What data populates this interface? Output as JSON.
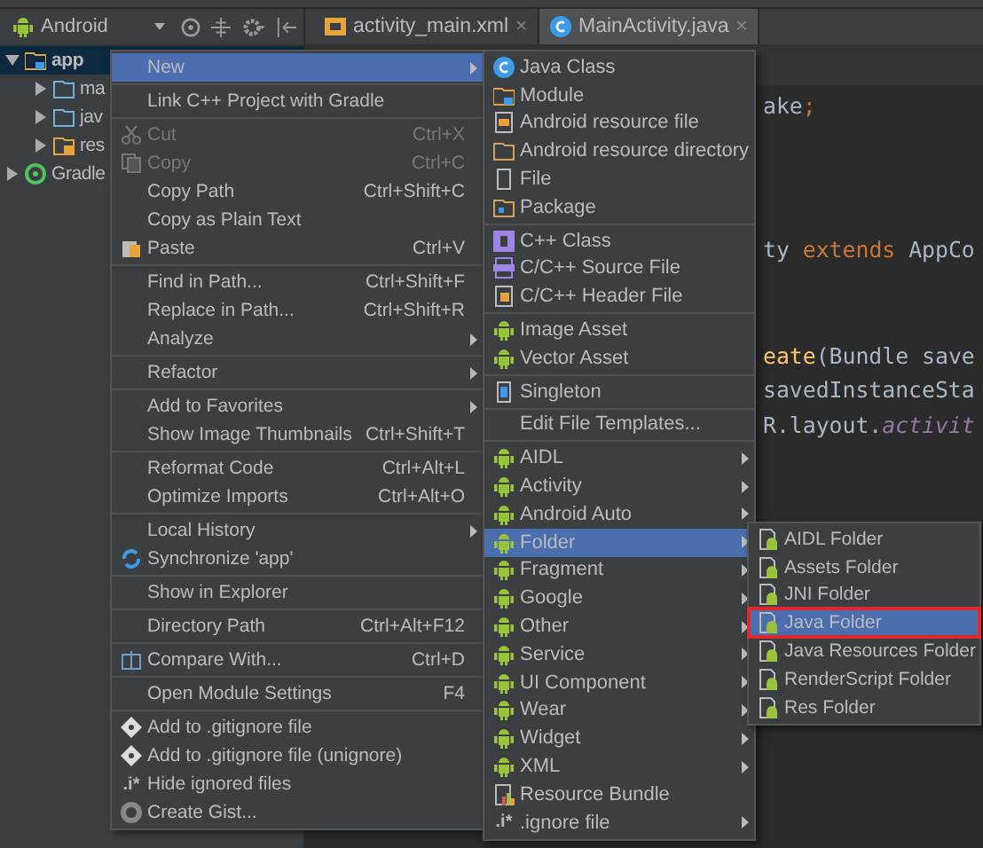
{
  "project_panel": {
    "view": "Android",
    "tree": [
      {
        "label": "app",
        "kind": "module",
        "selected": true,
        "expanded": true,
        "children": [
          {
            "label": "ma",
            "kind": "folder",
            "selected": false,
            "expanded": false
          },
          {
            "label": "jav",
            "kind": "folder",
            "selected": false,
            "expanded": false
          },
          {
            "label": "res",
            "kind": "res",
            "selected": false,
            "expanded": false
          }
        ]
      },
      {
        "label": "Gradle",
        "kind": "gradle",
        "selected": false,
        "expanded": false
      }
    ]
  },
  "tabs": [
    {
      "label": "activity_main.xml",
      "kind": "xml",
      "close": "×",
      "selected": false
    },
    {
      "label": "MainActivity.java",
      "kind": "class",
      "close": "×",
      "selected": true
    }
  ],
  "editor": {
    "lines": [
      [
        {
          "text": "ake",
          "kind": "plain"
        },
        {
          "text": ";",
          "kind": "keyword"
        }
      ],
      [
        {
          "text": "ty ",
          "kind": "plain"
        },
        {
          "text": "extends",
          "kind": "keyword"
        },
        {
          "text": " AppCo",
          "kind": "plain"
        }
      ],
      [
        {
          "text": "eate",
          "kind": "call"
        },
        {
          "text": "(Bundle save",
          "kind": "plain"
        }
      ],
      [
        {
          "text": "savedInstanceSta",
          "kind": "plain"
        }
      ],
      [
        {
          "text": "R.layout.",
          "kind": "plain"
        },
        {
          "text": "activit",
          "kind": "field"
        }
      ]
    ]
  },
  "context_menu": {
    "groups": [
      [
        {
          "label": "New",
          "submenu": true,
          "selected": true,
          "disabled": false
        }
      ],
      [
        {
          "label": "Link C++ Project with Gradle",
          "submenu": false,
          "selected": false,
          "disabled": false
        }
      ],
      [
        {
          "label": "Cut",
          "shortcut": "Ctrl+X",
          "kind": "scissors",
          "submenu": false,
          "selected": false,
          "disabled": true
        },
        {
          "label": "Copy",
          "shortcut": "Ctrl+C",
          "kind": "copy",
          "submenu": false,
          "selected": false,
          "disabled": true
        },
        {
          "label": "Copy Path",
          "shortcut": "Ctrl+Shift+C",
          "submenu": false,
          "selected": false,
          "disabled": false
        },
        {
          "label": "Copy as Plain Text",
          "submenu": false,
          "selected": false,
          "disabled": false
        },
        {
          "label": "Paste",
          "shortcut": "Ctrl+V",
          "kind": "paste",
          "submenu": false,
          "selected": false,
          "disabled": false
        }
      ],
      [
        {
          "label": "Find in Path...",
          "shortcut": "Ctrl+Shift+F",
          "submenu": false,
          "selected": false,
          "disabled": false
        },
        {
          "label": "Replace in Path...",
          "shortcut": "Ctrl+Shift+R",
          "submenu": false,
          "selected": false,
          "disabled": false
        },
        {
          "label": "Analyze",
          "submenu": true,
          "selected": false,
          "disabled": false
        }
      ],
      [
        {
          "label": "Refactor",
          "submenu": true,
          "selected": false,
          "disabled": false
        }
      ],
      [
        {
          "label": "Add to Favorites",
          "submenu": true,
          "selected": false,
          "disabled": false
        },
        {
          "label": "Show Image Thumbnails",
          "shortcut": "Ctrl+Shift+T",
          "submenu": false,
          "selected": false,
          "disabled": false
        }
      ],
      [
        {
          "label": "Reformat Code",
          "shortcut": "Ctrl+Alt+L",
          "submenu": false,
          "selected": false,
          "disabled": false
        },
        {
          "label": "Optimize Imports",
          "shortcut": "Ctrl+Alt+O",
          "submenu": false,
          "selected": false,
          "disabled": false
        }
      ],
      [
        {
          "label": "Local History",
          "submenu": true,
          "selected": false,
          "disabled": false
        },
        {
          "label": "Synchronize 'app'",
          "kind": "sync",
          "submenu": false,
          "selected": false,
          "disabled": false
        }
      ],
      [
        {
          "label": "Show in Explorer",
          "submenu": false,
          "selected": false,
          "disabled": false
        }
      ],
      [
        {
          "label": "Directory Path",
          "shortcut": "Ctrl+Alt+F12",
          "submenu": false,
          "selected": false,
          "disabled": false
        }
      ],
      [
        {
          "label": "Compare With...",
          "shortcut": "Ctrl+D",
          "kind": "compare",
          "submenu": false,
          "selected": false,
          "disabled": false
        }
      ],
      [
        {
          "label": "Open Module Settings",
          "shortcut": "F4",
          "submenu": false,
          "selected": false,
          "disabled": false
        }
      ],
      [
        {
          "label": "Add to .gitignore file",
          "kind": "git",
          "submenu": false,
          "selected": false,
          "disabled": false
        },
        {
          "label": "Add to .gitignore file (unignore)",
          "kind": "git",
          "submenu": false,
          "selected": false,
          "disabled": false
        },
        {
          "label": "Hide ignored files",
          "icon_text": ".i*",
          "submenu": false,
          "selected": false,
          "disabled": false
        },
        {
          "label": "Create Gist...",
          "kind": "gist",
          "submenu": false,
          "selected": false,
          "disabled": false
        }
      ]
    ]
  },
  "new_menu": {
    "groups": [
      [
        {
          "label": "Java Class",
          "kind": "class",
          "submenu": false,
          "selected": false
        },
        {
          "label": "Module",
          "kind": "module",
          "submenu": false,
          "selected": false
        },
        {
          "label": "Android resource file",
          "kind": "resfile",
          "submenu": false,
          "selected": false
        },
        {
          "label": "Android resource directory",
          "kind": "resdir",
          "submenu": false,
          "selected": false
        },
        {
          "label": "File",
          "kind": "file",
          "submenu": false,
          "selected": false
        },
        {
          "label": "Package",
          "kind": "package",
          "submenu": false,
          "selected": false
        }
      ],
      [
        {
          "label": "C++ Class",
          "kind": "cppclass",
          "submenu": false,
          "selected": false
        },
        {
          "label": "C/C++ Source File",
          "kind": "csource",
          "submenu": false,
          "selected": false
        },
        {
          "label": "C/C++ Header File",
          "kind": "cheader",
          "submenu": false,
          "selected": false
        }
      ],
      [
        {
          "label": "Image Asset",
          "kind": "android",
          "submenu": false,
          "selected": false
        },
        {
          "label": "Vector Asset",
          "kind": "android",
          "submenu": false,
          "selected": false
        }
      ],
      [
        {
          "label": "Singleton",
          "kind": "singleton",
          "submenu": false,
          "selected": false
        }
      ],
      [
        {
          "label": "Edit File Templates...",
          "submenu": false,
          "selected": false
        }
      ],
      [
        {
          "label": "AIDL",
          "kind": "android",
          "submenu": true,
          "selected": false
        },
        {
          "label": "Activity",
          "kind": "android",
          "submenu": true,
          "selected": false
        },
        {
          "label": "Android Auto",
          "kind": "android",
          "submenu": true,
          "selected": false
        },
        {
          "label": "Folder",
          "kind": "android",
          "submenu": true,
          "selected": true
        },
        {
          "label": "Fragment",
          "kind": "android",
          "submenu": true,
          "selected": false
        },
        {
          "label": "Google",
          "kind": "android",
          "submenu": true,
          "selected": false
        },
        {
          "label": "Other",
          "kind": "android",
          "submenu": true,
          "selected": false
        },
        {
          "label": "Service",
          "kind": "android",
          "submenu": true,
          "selected": false
        },
        {
          "label": "UI Component",
          "kind": "android",
          "submenu": true,
          "selected": false
        },
        {
          "label": "Wear",
          "kind": "android",
          "submenu": true,
          "selected": false
        },
        {
          "label": "Widget",
          "kind": "android",
          "submenu": true,
          "selected": false
        },
        {
          "label": "XML",
          "kind": "android",
          "submenu": true,
          "selected": false
        },
        {
          "label": "Resource Bundle",
          "kind": "bundle",
          "submenu": false,
          "selected": false
        },
        {
          "label": ".ignore file",
          "icon_text": ".i*",
          "submenu": true,
          "selected": false
        }
      ]
    ]
  },
  "folder_menu": {
    "items": [
      {
        "label": "AIDL Folder",
        "selected": false
      },
      {
        "label": "Assets Folder",
        "selected": false
      },
      {
        "label": "JNI Folder",
        "selected": false
      },
      {
        "label": "Java Folder",
        "selected": true
      },
      {
        "label": "Java Resources Folder",
        "selected": false
      },
      {
        "label": "RenderScript Folder",
        "selected": false
      },
      {
        "label": "Res Folder",
        "selected": false
      }
    ]
  }
}
